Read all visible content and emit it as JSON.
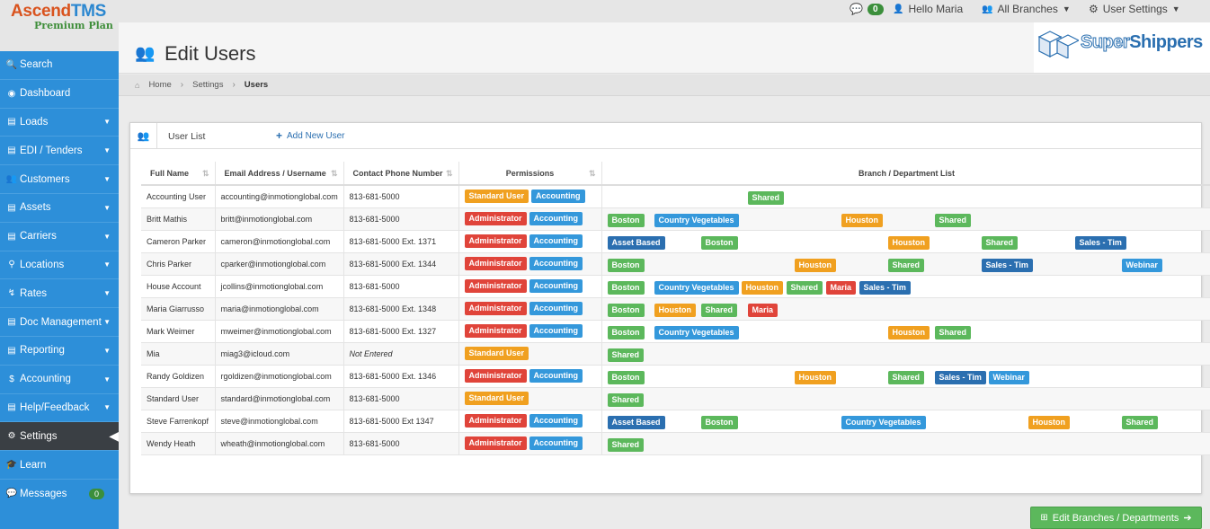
{
  "app": {
    "logo_main": "Ascend",
    "logo_tms": "TMS",
    "plan": "Premium Plan"
  },
  "topbar": {
    "messages_count": "0",
    "greeting": "Hello Maria",
    "branches": "All Branches",
    "user_settings": "User Settings"
  },
  "sidebar": {
    "items": [
      {
        "label": "Search",
        "icon": "search-icon",
        "glyph": "🔍",
        "caret": false
      },
      {
        "label": "Dashboard",
        "icon": "dashboard-icon",
        "glyph": "◉",
        "caret": false
      },
      {
        "label": "Loads",
        "icon": "list-icon",
        "glyph": "▤",
        "caret": true
      },
      {
        "label": "EDI / Tenders",
        "icon": "list-icon",
        "glyph": "▤",
        "caret": true
      },
      {
        "label": "Customers",
        "icon": "users-icon",
        "glyph": "👥",
        "caret": true
      },
      {
        "label": "Assets",
        "icon": "list-icon",
        "glyph": "▤",
        "caret": true
      },
      {
        "label": "Carriers",
        "icon": "list-icon",
        "glyph": "▤",
        "caret": true
      },
      {
        "label": "Locations",
        "icon": "map-marker-icon",
        "glyph": "⚲",
        "caret": true
      },
      {
        "label": "Rates",
        "icon": "rates-icon",
        "glyph": "↯",
        "caret": true
      },
      {
        "label": "Doc Management",
        "icon": "document-icon",
        "glyph": "▤",
        "caret": true
      },
      {
        "label": "Reporting",
        "icon": "document-icon",
        "glyph": "▤",
        "caret": true
      },
      {
        "label": "Accounting",
        "icon": "dollar-icon",
        "glyph": "$",
        "caret": true
      },
      {
        "label": "Help/Feedback",
        "icon": "document-icon",
        "glyph": "▤",
        "caret": true
      },
      {
        "label": "Settings",
        "icon": "gear-icon",
        "glyph": "⚙",
        "caret": false,
        "active": true
      },
      {
        "label": "Learn",
        "icon": "graduation-icon",
        "glyph": "🎓",
        "caret": false
      },
      {
        "label": "Messages",
        "icon": "comment-icon",
        "glyph": "💬",
        "caret": false,
        "badge": "0"
      }
    ]
  },
  "page": {
    "title": "Edit Users"
  },
  "brand": {
    "part1": "Super",
    "part2": "Shippers"
  },
  "breadcrumb": {
    "home": "Home",
    "settings": "Settings",
    "current": "Users"
  },
  "panel": {
    "title": "User List",
    "add_user": "Add New User",
    "columns": [
      "Full Name",
      "Email Address / Username",
      "Contact Phone Number",
      "Permissions",
      "Branch / Department List"
    ],
    "rows": [
      {
        "name": "Accounting User",
        "email": "accounting@inmotionglobal.com",
        "phone": "813-681-5000",
        "perms": [
          {
            "label": "Standard User",
            "color": "#f0a020"
          },
          {
            "label": "Accounting",
            "color": "#3498db"
          }
        ],
        "branches": [
          {
            "label": "Shared",
            "color": "#5cb85c",
            "col": 3
          }
        ]
      },
      {
        "name": "Britt Mathis",
        "email": "britt@inmotionglobal.com",
        "phone": "813-681-5000",
        "perms": [
          {
            "label": "Administrator",
            "color": "#e0443a"
          },
          {
            "label": "Accounting",
            "color": "#3498db"
          }
        ],
        "branches": [
          {
            "label": "Boston",
            "color": "#5cb85c",
            "col": 0
          },
          {
            "label": "Country Vegetables",
            "color": "#3498db",
            "col": 1
          },
          {
            "label": "Houston",
            "color": "#f0a020",
            "col": 5
          },
          {
            "label": "Shared",
            "color": "#5cb85c",
            "col": 7
          }
        ]
      },
      {
        "name": "Cameron Parker",
        "email": "cameron@inmotionglobal.com",
        "phone": "813-681-5000 Ext. 1371",
        "perms": [
          {
            "label": "Administrator",
            "color": "#e0443a"
          },
          {
            "label": "Accounting",
            "color": "#3498db"
          }
        ],
        "branches": [
          {
            "label": "Asset Based",
            "color": "#2b6fb0",
            "col": 0
          },
          {
            "label": "Boston",
            "color": "#5cb85c",
            "col": 2
          },
          {
            "label": "Houston",
            "color": "#f0a020",
            "col": 6
          },
          {
            "label": "Shared",
            "color": "#5cb85c",
            "col": 8
          },
          {
            "label": "Sales - Tim",
            "color": "#2b6fb0",
            "col": 10
          }
        ]
      },
      {
        "name": "Chris Parker",
        "email": "cparker@inmotionglobal.com",
        "phone": "813-681-5000 Ext. 1344",
        "perms": [
          {
            "label": "Administrator",
            "color": "#e0443a"
          },
          {
            "label": "Accounting",
            "color": "#3498db"
          }
        ],
        "branches": [
          {
            "label": "Boston",
            "color": "#5cb85c",
            "col": 0
          },
          {
            "label": "Houston",
            "color": "#f0a020",
            "col": 4
          },
          {
            "label": "Shared",
            "color": "#5cb85c",
            "col": 6
          },
          {
            "label": "Sales - Tim",
            "color": "#2b6fb0",
            "col": 8
          },
          {
            "label": "Webinar",
            "color": "#3498db",
            "col": 11
          }
        ]
      },
      {
        "name": "House Account",
        "email": "jcollins@inmotionglobal.com",
        "phone": "813-681-5000",
        "perms": [
          {
            "label": "Administrator",
            "color": "#e0443a"
          },
          {
            "label": "Accounting",
            "color": "#3498db"
          }
        ],
        "branches": [
          {
            "label": "Boston",
            "color": "#5cb85c",
            "col": 0
          },
          {
            "label": "Country Vegetables",
            "color": "#3498db",
            "col": 1
          },
          {
            "label": "Houston",
            "color": "#f0a020",
            "col": 2
          },
          {
            "label": "Shared",
            "color": "#5cb85c",
            "col": 3
          },
          {
            "label": "Maria",
            "color": "#e0443a",
            "col": 4
          },
          {
            "label": "Sales - Tim",
            "color": "#2b6fb0",
            "col": 5
          }
        ]
      },
      {
        "name": "Maria Giarrusso",
        "email": "maria@inmotionglobal.com",
        "phone": "813-681-5000 Ext. 1348",
        "perms": [
          {
            "label": "Administrator",
            "color": "#e0443a"
          },
          {
            "label": "Accounting",
            "color": "#3498db"
          }
        ],
        "branches": [
          {
            "label": "Boston",
            "color": "#5cb85c",
            "col": 0
          },
          {
            "label": "Houston",
            "color": "#f0a020",
            "col": 1
          },
          {
            "label": "Shared",
            "color": "#5cb85c",
            "col": 2
          },
          {
            "label": "Maria",
            "color": "#e0443a",
            "col": 3
          }
        ]
      },
      {
        "name": "Mark Weimer",
        "email": "mweimer@inmotionglobal.com",
        "phone": "813-681-5000 Ext. 1327",
        "perms": [
          {
            "label": "Administrator",
            "color": "#e0443a"
          },
          {
            "label": "Accounting",
            "color": "#3498db"
          }
        ],
        "branches": [
          {
            "label": "Boston",
            "color": "#5cb85c",
            "col": 0
          },
          {
            "label": "Country Vegetables",
            "color": "#3498db",
            "col": 1
          },
          {
            "label": "Houston",
            "color": "#f0a020",
            "col": 6
          },
          {
            "label": "Shared",
            "color": "#5cb85c",
            "col": 7
          }
        ]
      },
      {
        "name": "Mia",
        "email": "miag3@icloud.com",
        "phone": "Not Entered",
        "phone_missing": true,
        "perms": [
          {
            "label": "Standard User",
            "color": "#f0a020"
          }
        ],
        "branches": [
          {
            "label": "Shared",
            "color": "#5cb85c",
            "col": 0
          }
        ]
      },
      {
        "name": "Randy Goldizen",
        "email": "rgoldizen@inmotionglobal.com",
        "phone": "813-681-5000 Ext. 1346",
        "perms": [
          {
            "label": "Administrator",
            "color": "#e0443a"
          },
          {
            "label": "Accounting",
            "color": "#3498db"
          }
        ],
        "branches": [
          {
            "label": "Boston",
            "color": "#5cb85c",
            "col": 0
          },
          {
            "label": "Houston",
            "color": "#f0a020",
            "col": 4
          },
          {
            "label": "Shared",
            "color": "#5cb85c",
            "col": 6
          },
          {
            "label": "Sales - Tim",
            "color": "#2b6fb0",
            "col": 7
          },
          {
            "label": "Webinar",
            "color": "#3498db",
            "col": 8
          }
        ]
      },
      {
        "name": "Standard User",
        "email": "standard@inmotionglobal.com",
        "phone": "813-681-5000",
        "perms": [
          {
            "label": "Standard User",
            "color": "#f0a020"
          }
        ],
        "branches": [
          {
            "label": "Shared",
            "color": "#5cb85c",
            "col": 0
          }
        ]
      },
      {
        "name": "Steve Farrenkopf",
        "email": "steve@inmotionglobal.com",
        "phone": "813-681-5000 Ext 1347",
        "perms": [
          {
            "label": "Administrator",
            "color": "#e0443a"
          },
          {
            "label": "Accounting",
            "color": "#3498db"
          }
        ],
        "branches": [
          {
            "label": "Asset Based",
            "color": "#2b6fb0",
            "col": 0
          },
          {
            "label": "Boston",
            "color": "#5cb85c",
            "col": 2
          },
          {
            "label": "Country Vegetables",
            "color": "#3498db",
            "col": 5
          },
          {
            "label": "Houston",
            "color": "#f0a020",
            "col": 9
          },
          {
            "label": "Shared",
            "color": "#5cb85c",
            "col": 11
          }
        ]
      },
      {
        "name": "Wendy Heath",
        "email": "wheath@inmotionglobal.com",
        "phone": "813-681-5000",
        "perms": [
          {
            "label": "Administrator",
            "color": "#e0443a"
          },
          {
            "label": "Accounting",
            "color": "#3498db"
          }
        ],
        "branches": [
          {
            "label": "Shared",
            "color": "#5cb85c",
            "col": 0
          }
        ]
      }
    ]
  },
  "edit_branches_button": "Edit Branches / Departments"
}
